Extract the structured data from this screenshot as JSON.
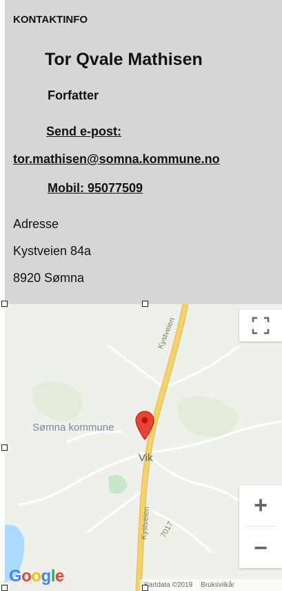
{
  "contact": {
    "heading": "KONTAKTINFO",
    "name": "Tor Qvale Mathisen",
    "role": "Forfatter",
    "email_label": "Send e-post:",
    "email": "tor.mathisen@somna.kommune.no",
    "mobile": "Mobil: 95077509",
    "address_label": "Adresse",
    "street": "Kystveien 84a",
    "postal_city": "8920 Sømna"
  },
  "map": {
    "place_label": "Sømna kommune",
    "village_label": "Vik",
    "road_label": "Kystveien",
    "road_number": "7017",
    "zoom_in": "+",
    "zoom_out": "−",
    "logo": {
      "g1": "G",
      "o1": "o",
      "o2": "o",
      "g2": "g",
      "l": "l",
      "e": "e"
    },
    "attribution": {
      "data": "Kartdata ©2019",
      "terms": "Bruksvilkår"
    },
    "colors": {
      "road": "#f6d36a",
      "marker": "#ea4335",
      "water": "#aadaff",
      "park": "#c8e6c9"
    }
  }
}
